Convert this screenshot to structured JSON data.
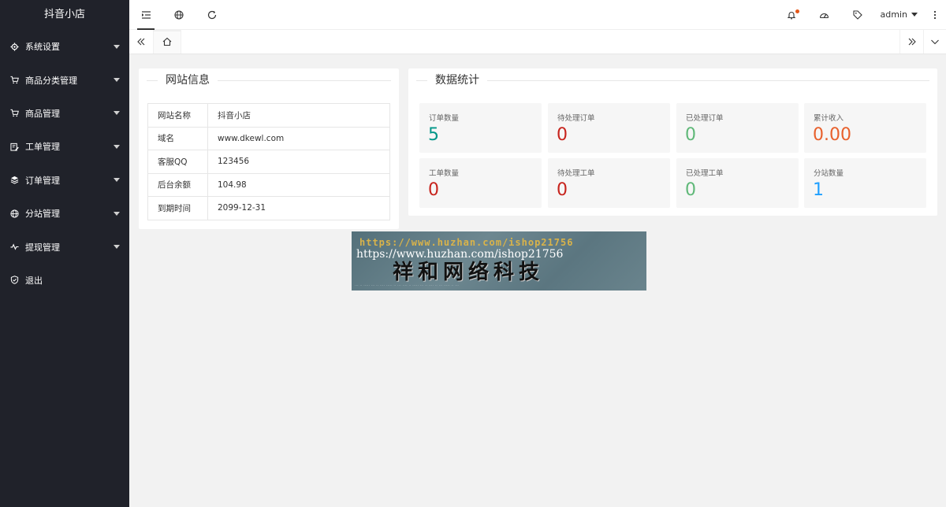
{
  "app": {
    "title": "抖音小店"
  },
  "sidebar": {
    "items": [
      {
        "label": "系统设置",
        "icon": "gear-icon"
      },
      {
        "label": "商品分类管理",
        "icon": "cart-icon"
      },
      {
        "label": "商品管理",
        "icon": "cart-icon"
      },
      {
        "label": "工单管理",
        "icon": "edit-icon"
      },
      {
        "label": "订单管理",
        "icon": "layers-icon"
      },
      {
        "label": "分站管理",
        "icon": "globe-icon"
      },
      {
        "label": "提现管理",
        "icon": "pulse-icon"
      },
      {
        "label": "退出",
        "icon": "shield-icon"
      }
    ]
  },
  "header": {
    "user": "admin"
  },
  "site_info": {
    "title": "网站信息",
    "rows": [
      {
        "key": "网站名称",
        "value": "抖音小店"
      },
      {
        "key": "域名",
        "value": "www.dkewl.com"
      },
      {
        "key": "客服QQ",
        "value": "123456"
      },
      {
        "key": "后台余额",
        "value": "104.98"
      },
      {
        "key": "到期时间",
        "value": "2099-12-31"
      }
    ]
  },
  "stats": {
    "title": "数据统计",
    "items": [
      {
        "label": "订单数量",
        "value": "5",
        "color": "#009688"
      },
      {
        "label": "待处理订单",
        "value": "0",
        "color": "#c7241d"
      },
      {
        "label": "已处理订单",
        "value": "0",
        "color": "#5fb878"
      },
      {
        "label": "累计收入",
        "value": "0.00",
        "color": "#e8602c"
      },
      {
        "label": "工单数量",
        "value": "0",
        "color": "#c7241d"
      },
      {
        "label": "待处理工单",
        "value": "0",
        "color": "#c7241d"
      },
      {
        "label": "已处理工单",
        "value": "0",
        "color": "#5fb878"
      },
      {
        "label": "分站数量",
        "value": "1",
        "color": "#1e9fff"
      }
    ]
  },
  "watermark": {
    "line1": "https://www.huzhan.com/ishop21756",
    "line2": "https://www.huzhan.com/ishop21756",
    "line3": "祥和网络科技"
  }
}
